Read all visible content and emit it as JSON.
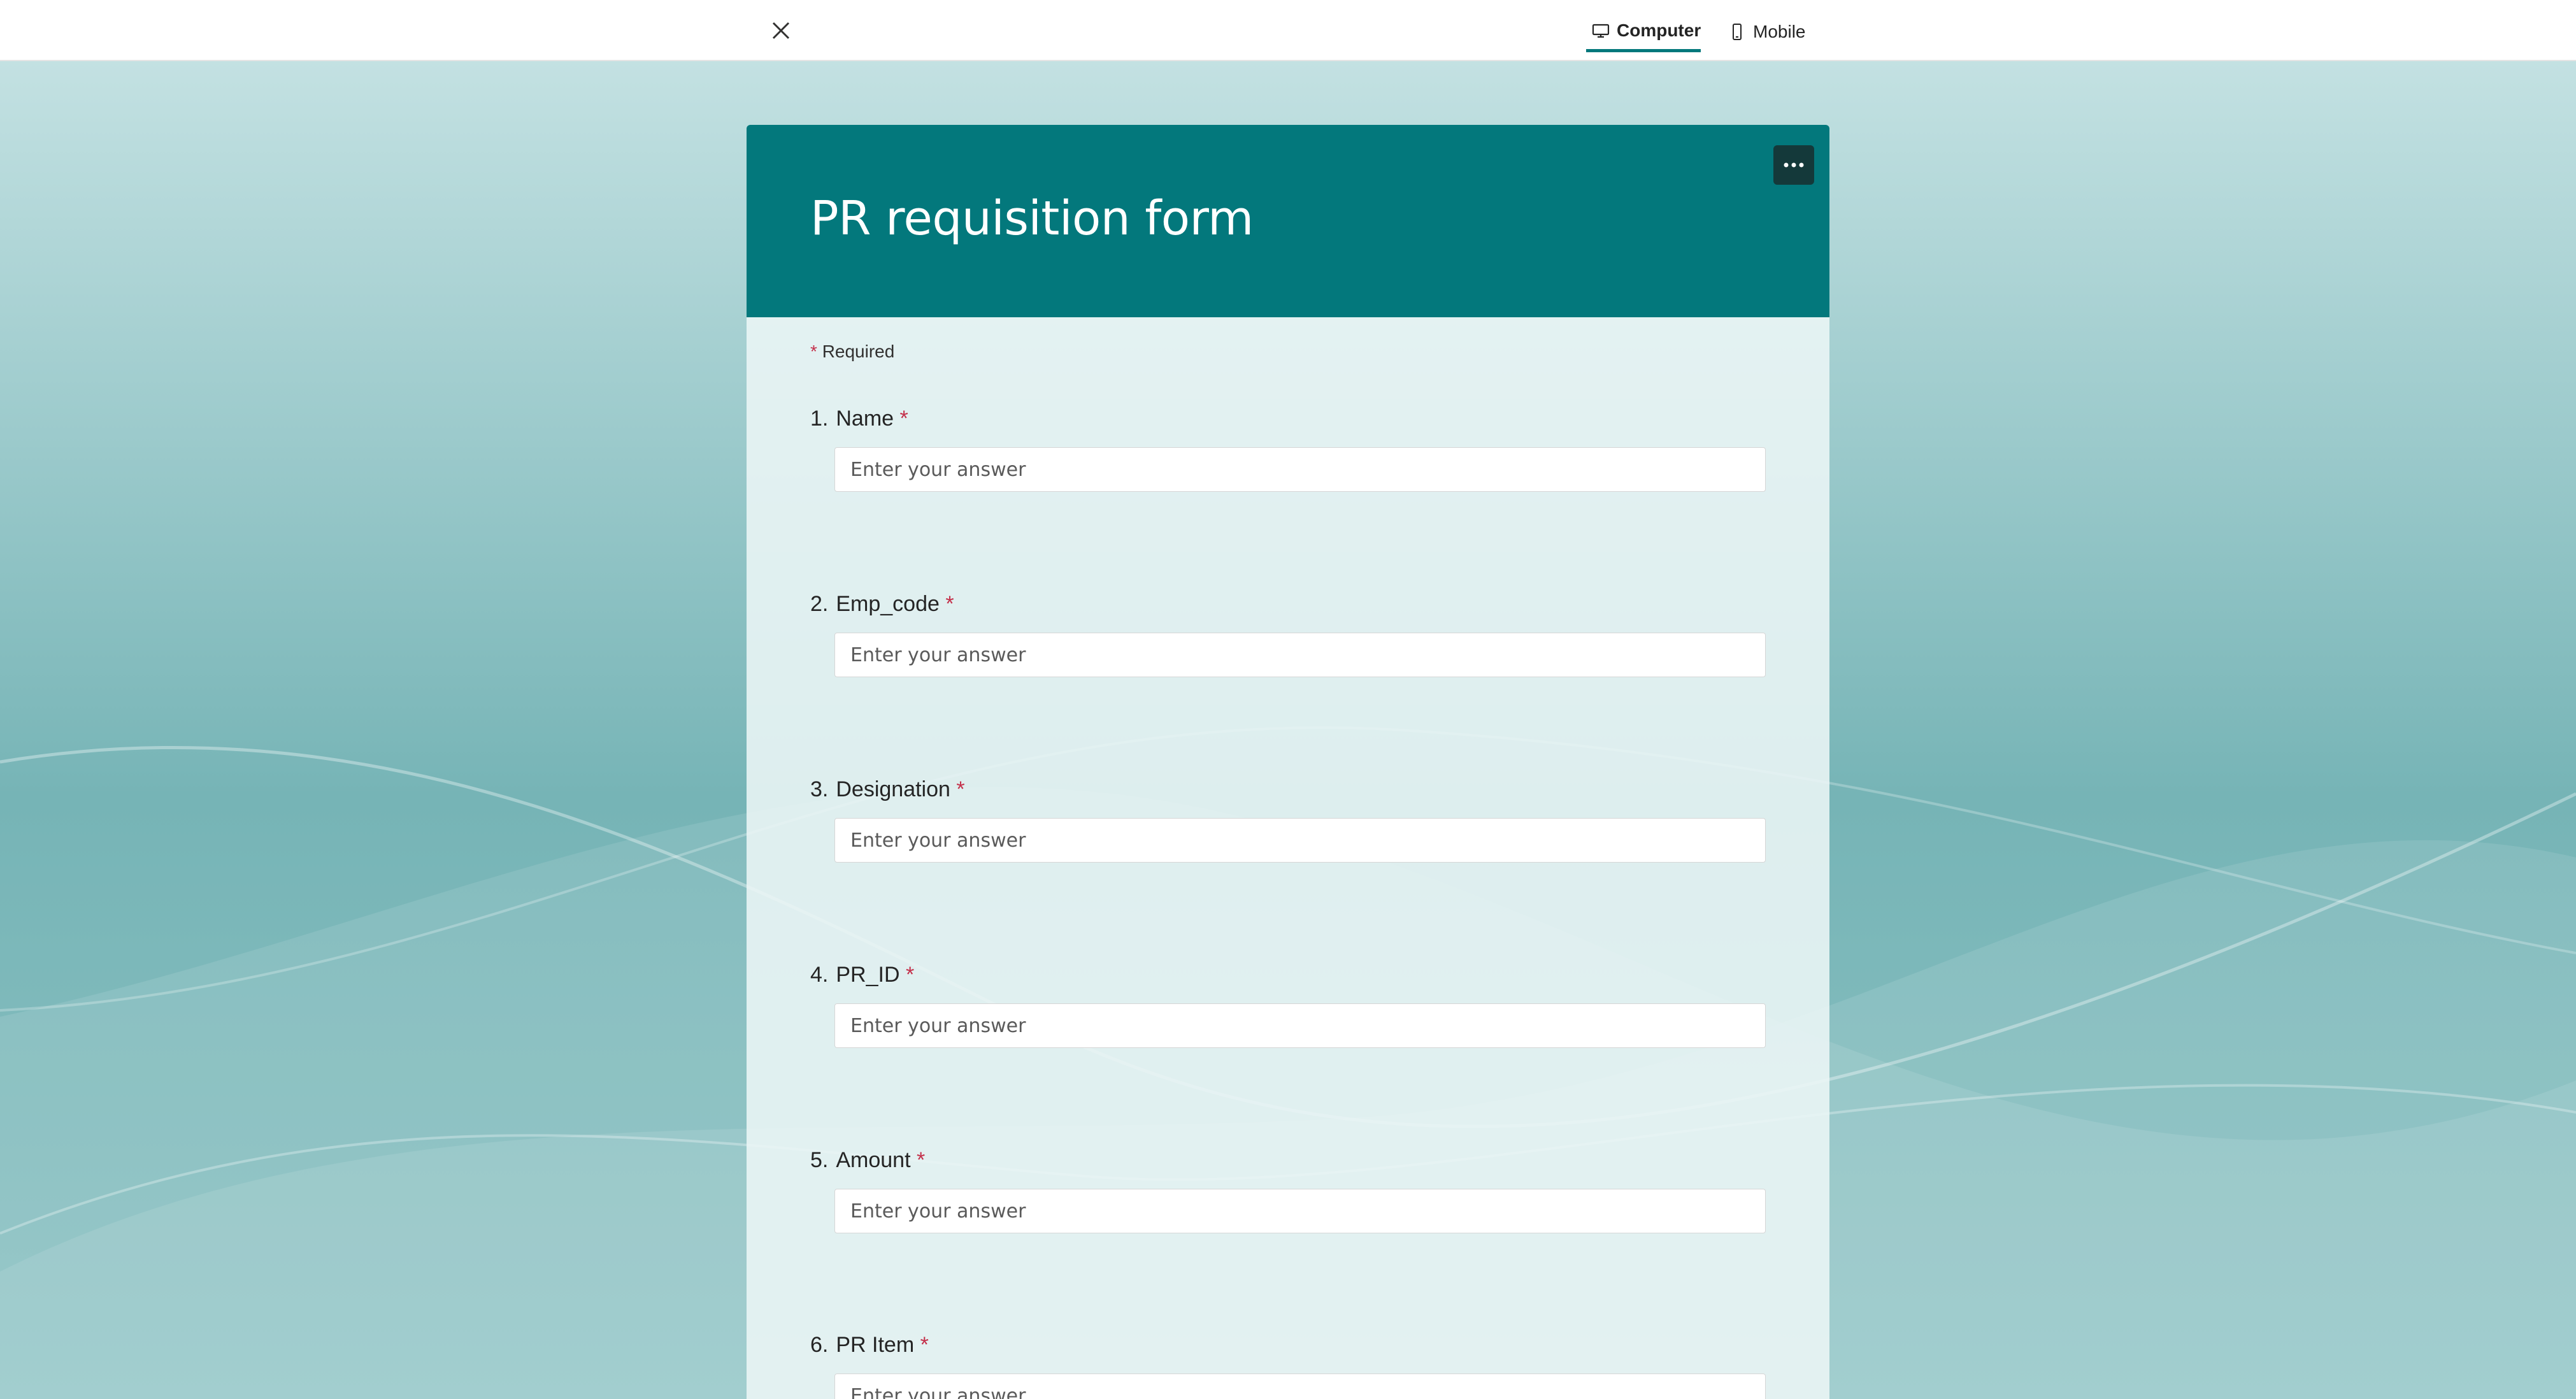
{
  "topbar": {
    "tabs": [
      {
        "label": "Computer",
        "icon": "monitor-icon",
        "active": true
      },
      {
        "label": "Mobile",
        "icon": "phone-icon",
        "active": false
      }
    ]
  },
  "form": {
    "title": "PR requisition form",
    "required_note": "Required",
    "required_marker": "*",
    "theme_color": "#03787c",
    "questions": [
      {
        "number": "1.",
        "label": "Name",
        "placeholder": "Enter your answer"
      },
      {
        "number": "2.",
        "label": "Emp_code",
        "placeholder": "Enter your answer"
      },
      {
        "number": "3.",
        "label": "Designation",
        "placeholder": "Enter your answer"
      },
      {
        "number": "4.",
        "label": "PR_ID",
        "placeholder": "Enter your answer"
      },
      {
        "number": "5.",
        "label": "Amount",
        "placeholder": "Enter your answer"
      },
      {
        "number": "6.",
        "label": "PR Item",
        "placeholder": "Enter your answer"
      }
    ]
  }
}
